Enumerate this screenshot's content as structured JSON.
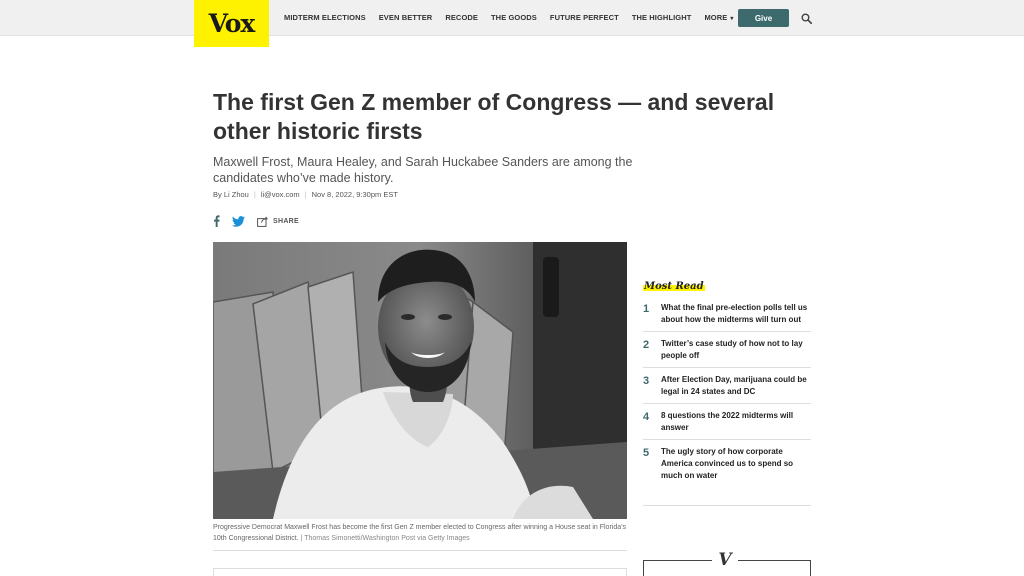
{
  "brand": {
    "logo_text": "Vox",
    "logo_color": "#fff200"
  },
  "nav": {
    "items": [
      "MIDTERM ELECTIONS",
      "EVEN BETTER",
      "RECODE",
      "THE GOODS",
      "FUTURE PERFECT",
      "THE HIGHLIGHT",
      "MORE"
    ],
    "more_caret": "▾"
  },
  "header": {
    "give_label": "Give",
    "give_color": "#3c6a6d",
    "search_icon": "search-icon"
  },
  "article": {
    "headline": "The first Gen Z member of Congress — and several other historic firsts",
    "dek": "Maxwell Frost, Maura Healey, and Sarah Huckabee Sanders are among the candidates who’ve made history.",
    "byline": {
      "author": "By Li Zhou",
      "email": "li@vox.com",
      "date": "Nov 8, 2022, 9:30pm EST"
    },
    "share": {
      "label": "SHARE",
      "icons": [
        "facebook-icon",
        "twitter-icon",
        "share-icon"
      ]
    },
    "photo": {
      "caption": "Progressive Democrat Maxwell Frost has become the first Gen Z member elected to Congress after winning a House seat in Florida’s 10th Congressional District.",
      "credit": "Thomas Simonetti/Washington Post via Getty Images"
    }
  },
  "most_read": {
    "title": "Most Read",
    "items": [
      {
        "num": "1",
        "text": "What the final pre-election polls tell us about how the midterms will turn out"
      },
      {
        "num": "2",
        "text": "Twitter’s case study of how not to lay people off"
      },
      {
        "num": "3",
        "text": "After Election Day, marijuana could be legal in 24 states and DC"
      },
      {
        "num": "4",
        "text": "8 questions the 2022 midterms will answer"
      },
      {
        "num": "5",
        "text": "The ugly story of how corporate America convinced us to spend so much on water"
      }
    ]
  },
  "sidebar_badge": "V"
}
